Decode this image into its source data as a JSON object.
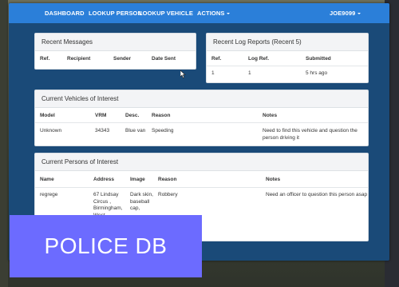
{
  "nav": {
    "dashboard": "DASHBOARD",
    "lookup_person": "LOOKUP PERSON",
    "lookup_vehicle": "LOOKUP VEHICLE",
    "actions": "ACTIONS",
    "user": "JOE9099"
  },
  "recent_messages": {
    "title": "Recent Messages",
    "columns": [
      "Ref.",
      "Recipient",
      "Sender",
      "Date Sent"
    ]
  },
  "recent_logs": {
    "title": "Recent Log Reports (Recent 5)",
    "columns": [
      "Ref.",
      "Log Ref.",
      "Submitted"
    ],
    "rows": [
      [
        "1",
        "1",
        "5 hrs ago"
      ]
    ]
  },
  "vehicles": {
    "title": "Current Vehicles of Interest",
    "columns": [
      "Model",
      "VRM",
      "Desc.",
      "Reason",
      "Notes"
    ],
    "rows": [
      {
        "model": "Unknown",
        "vrm": "34343",
        "desc": "Blue van",
        "reason": "Speeding",
        "notes": "Need to find this vehicle and question the person driving it"
      }
    ]
  },
  "persons": {
    "title": "Current Persons of Interest",
    "columns": [
      "Name",
      "Address",
      "Image",
      "Reason",
      "Notes"
    ],
    "rows": [
      {
        "name": "regrege",
        "address": "67 Lindsay Circus , Birmingham, West",
        "image": "Dark skin, baseball cap,",
        "reason": "Robbery",
        "notes": "Need an officer to question this person asap"
      }
    ]
  },
  "banner": {
    "text": "POLICE DB"
  },
  "colors": {
    "navbar": "#2b7fd9",
    "background": "#1a4a78",
    "banner": "#6c6bff"
  },
  "icons": {
    "cursor": "mouse-pointer-icon",
    "dropdown": "caret-down-icon"
  }
}
